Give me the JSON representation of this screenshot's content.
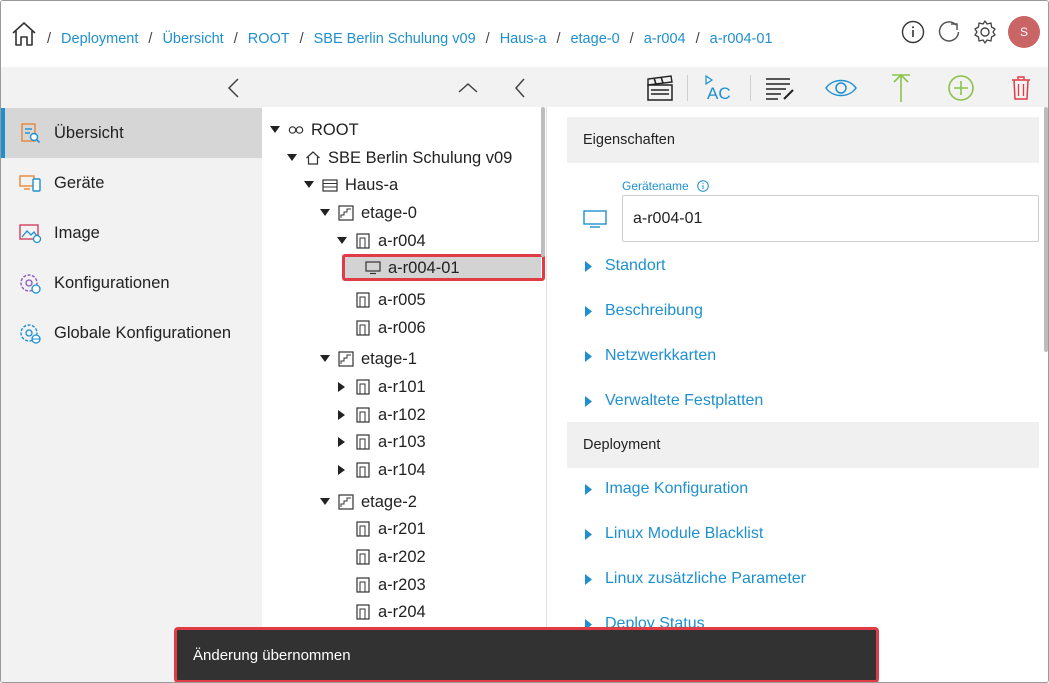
{
  "breadcrumb": {
    "home_icon": "home-icon",
    "separator": "/",
    "items": [
      "Deployment",
      "Übersicht",
      "ROOT",
      "SBE Berlin Schulung v09",
      "Haus-a",
      "etage-0",
      "a-r004",
      "a-r004-01"
    ]
  },
  "top_icons": [
    "info-icon",
    "refresh-icon",
    "gear-icon"
  ],
  "user": {
    "initial": "S",
    "avatar_color": "#c96565"
  },
  "sidebar": {
    "items": [
      {
        "label": "Übersicht",
        "icon": "overview-icon",
        "active": true
      },
      {
        "label": "Geräte",
        "icon": "devices-icon",
        "active": false
      },
      {
        "label": "Image",
        "icon": "image-icon",
        "active": false
      },
      {
        "label": "Konfigurationen",
        "icon": "configuration-icon",
        "active": false
      },
      {
        "label": "Globale Konfigurationen",
        "icon": "global-configuration-icon",
        "active": false
      }
    ]
  },
  "toolbar": {
    "buttons": [
      "collapse-up-icon",
      "back-icon",
      "clapperboard-icon",
      "autocomplete-icon",
      "list-edit-icon",
      "eye-icon",
      "arrow-up-icon",
      "add-circle-icon",
      "trash-icon"
    ]
  },
  "tree": {
    "nodes": [
      {
        "label": "ROOT",
        "type": "root",
        "expanded": true
      },
      {
        "label": "SBE Berlin Schulung v09",
        "type": "school",
        "expanded": true
      },
      {
        "label": "Haus-a",
        "type": "building",
        "expanded": true
      },
      {
        "label": "etage-0",
        "type": "floor",
        "expanded": true
      },
      {
        "label": "a-r004",
        "type": "room",
        "expanded": true
      },
      {
        "label": "a-r004-01",
        "type": "device",
        "selected": true
      },
      {
        "label": "a-r005",
        "type": "room"
      },
      {
        "label": "a-r006",
        "type": "room"
      },
      {
        "label": "etage-1",
        "type": "floor",
        "expanded": true
      },
      {
        "label": "a-r101",
        "type": "room",
        "expanded": false
      },
      {
        "label": "a-r102",
        "type": "room",
        "expanded": false
      },
      {
        "label": "a-r103",
        "type": "room",
        "expanded": false
      },
      {
        "label": "a-r104",
        "type": "room",
        "expanded": false
      },
      {
        "label": "etage-2",
        "type": "floor",
        "expanded": true
      },
      {
        "label": "a-r201",
        "type": "room"
      },
      {
        "label": "a-r202",
        "type": "room"
      },
      {
        "label": "a-r203",
        "type": "room"
      },
      {
        "label": "a-r204",
        "type": "room"
      }
    ]
  },
  "details": {
    "properties_header": "Eigenschaften",
    "device_name_label": "Gerätename",
    "device_name_value": "a-r004-01",
    "property_sections": [
      "Standort",
      "Beschreibung",
      "Netzwerkkarten",
      "Verwaltete Festplatten"
    ],
    "deployment_header": "Deployment",
    "deployment_sections": [
      "Image Konfiguration",
      "Linux Module Blacklist",
      "Linux zusätzliche Parameter",
      "Deploy Status"
    ]
  },
  "snackbar": {
    "message": "Änderung übernommen"
  },
  "colors": {
    "accent": "#1e90d0",
    "green": "#8bc34a",
    "red": "#e03c45",
    "sidebar_bg": "#f2f2f2"
  }
}
